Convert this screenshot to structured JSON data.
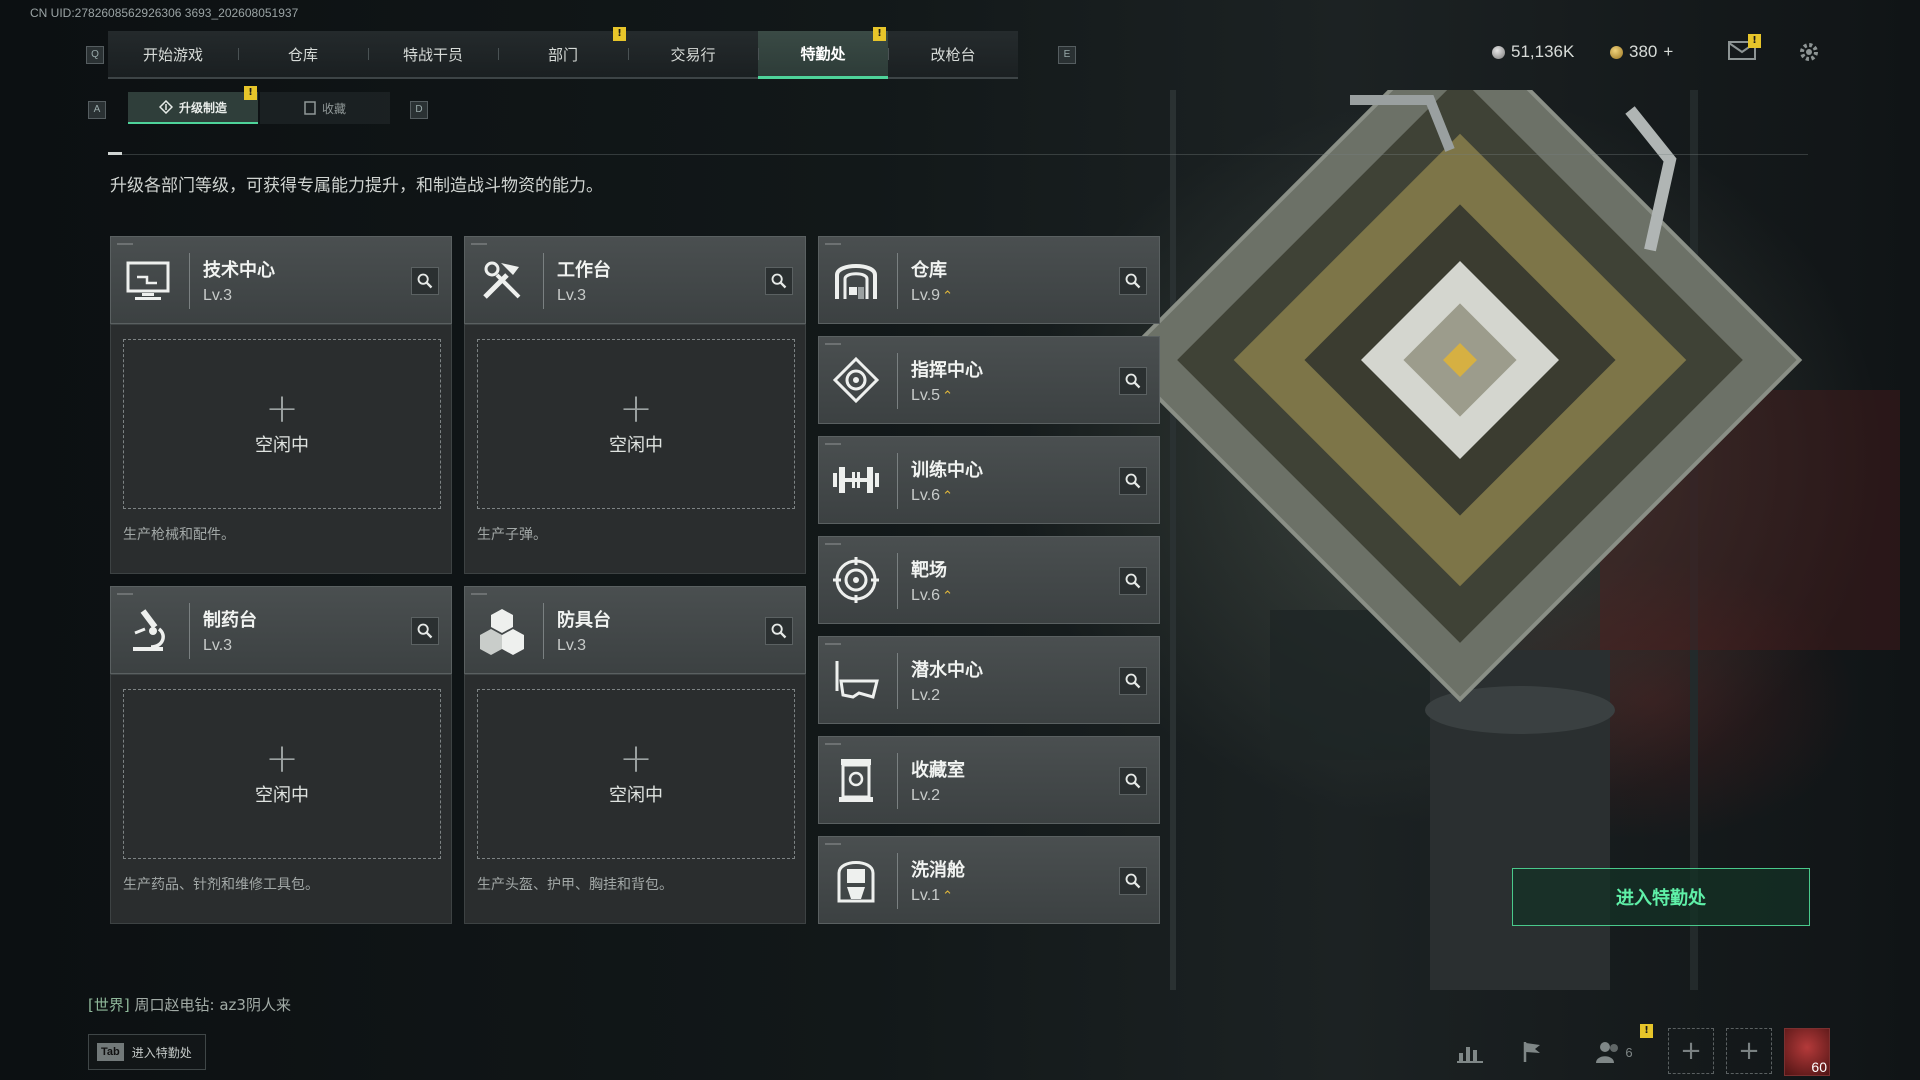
{
  "uid": "CN UID:2782608562926306 3693_202608051937",
  "nav": {
    "key_left": "Q",
    "key_right": "E",
    "tabs": [
      {
        "label": "开始游戏"
      },
      {
        "label": "仓库"
      },
      {
        "label": "特战干员"
      },
      {
        "label": "部门",
        "badge": "!"
      },
      {
        "label": "交易行"
      },
      {
        "label": "特勤处",
        "badge": "!",
        "active": true
      },
      {
        "label": "改枪台"
      }
    ]
  },
  "currency": {
    "silver": "51,136K",
    "gold": "380",
    "gold_add": "+"
  },
  "subtabs": {
    "key_left": "A",
    "key_right": "D",
    "upgrade": "升级制造",
    "upgrade_badge": "!",
    "collection": "收藏"
  },
  "description": "升级各部门等级，可获得专属能力提升，和制造战斗物资的能力。",
  "production": [
    {
      "name": "技术中心",
      "level": "Lv.3",
      "icon": "monitor-icon",
      "slot_plus": "+",
      "slot_status": "空闲中",
      "desc": "生产枪械和配件。"
    },
    {
      "name": "工作台",
      "level": "Lv.3",
      "icon": "tools-icon",
      "slot_plus": "+",
      "slot_status": "空闲中",
      "desc": "生产子弹。"
    },
    {
      "name": "制药台",
      "level": "Lv.3",
      "icon": "microscope-icon",
      "slot_plus": "+",
      "slot_status": "空闲中",
      "desc": "生产药品、针剂和维修工具包。"
    },
    {
      "name": "防具台",
      "level": "Lv.3",
      "icon": "cubes-icon",
      "slot_plus": "+",
      "slot_status": "空闲中",
      "desc": "生产头盔、护甲、胸挂和背包。"
    }
  ],
  "departments": [
    {
      "name": "仓库",
      "level": "Lv.9",
      "upgradable": true,
      "icon": "warehouse-icon"
    },
    {
      "name": "指挥中心",
      "level": "Lv.5",
      "upgradable": true,
      "icon": "command-icon"
    },
    {
      "name": "训练中心",
      "level": "Lv.6",
      "upgradable": true,
      "icon": "dumbbell-icon"
    },
    {
      "name": "靶场",
      "level": "Lv.6",
      "upgradable": true,
      "icon": "target-icon"
    },
    {
      "name": "潜水中心",
      "level": "Lv.2",
      "upgradable": false,
      "icon": "diving-mask-icon"
    },
    {
      "name": "收藏室",
      "level": "Lv.2",
      "upgradable": false,
      "icon": "collection-icon"
    },
    {
      "name": "洗消舱",
      "level": "Lv.1",
      "upgradable": true,
      "icon": "hazmat-icon"
    }
  ],
  "up_arrow": "⌃",
  "enter_button": "进入特勤处",
  "chat": {
    "channel": "[世界]",
    "sender": "周口赵电钻",
    "message": "az3阴人来"
  },
  "tab_hint": {
    "key": "Tab",
    "label": "进入特勤处"
  },
  "bottom": {
    "friends_count": "6",
    "friends_badge": "!",
    "level": "60"
  },
  "colors": {
    "accent": "#4ed39a",
    "badge": "#e7c52a",
    "upgrade_arrow": "#e2b83a"
  }
}
